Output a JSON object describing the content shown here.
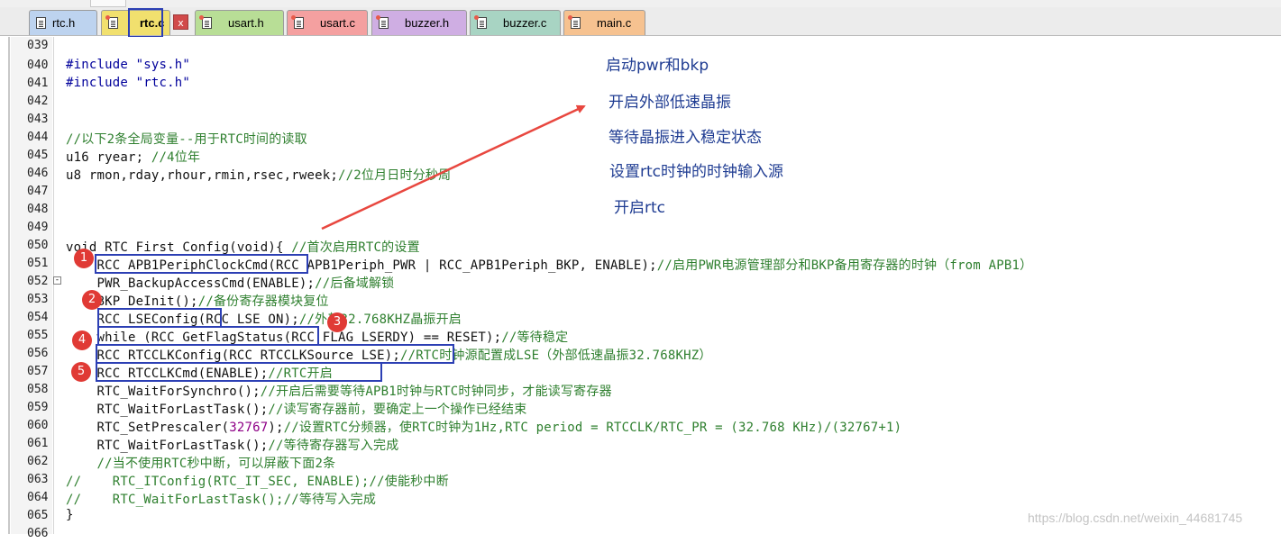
{
  "tabs": [
    {
      "label": "rtc.h",
      "color": "#bdd3ef",
      "modified": false
    },
    {
      "label": "rtc.c",
      "color": "#f1e06e",
      "modified": true,
      "active": true
    },
    {
      "label": "usart.h",
      "color": "#b8de96",
      "modified": true
    },
    {
      "label": "usart.c",
      "color": "#f4a0a0",
      "modified": true
    },
    {
      "label": "buzzer.h",
      "color": "#cfaee3",
      "modified": true
    },
    {
      "label": "buzzer.c",
      "color": "#a8d4c3",
      "modified": true
    },
    {
      "label": "main.c",
      "color": "#f6c290",
      "modified": true
    }
  ],
  "close_label": "x",
  "lines": [
    {
      "no": "039",
      "code": ""
    },
    {
      "no": "040",
      "code": "#include \"sys.h\""
    },
    {
      "no": "041",
      "code": "#include \"rtc.h\""
    },
    {
      "no": "042",
      "code": ""
    },
    {
      "no": "043",
      "code": ""
    },
    {
      "no": "044",
      "code": "//以下2条全局变量--用于RTC时间的读取"
    },
    {
      "no": "045",
      "code": "u16 ryear; //4位年"
    },
    {
      "no": "046",
      "code": "u8 rmon,rday,rhour,rmin,rsec,rweek;//2位月日时分秒周"
    },
    {
      "no": "047",
      "code": ""
    },
    {
      "no": "048",
      "code": ""
    },
    {
      "no": "049",
      "code": ""
    },
    {
      "no": "050",
      "code": "void RTC_First_Config(void){ //首次启用RTC的设置"
    },
    {
      "no": "051",
      "code": "    RCC_APB1PeriphClockCmd(RCC_APB1Periph_PWR | RCC_APB1Periph_BKP, ENABLE);//启用PWR电源管理部分和BKP备用寄存器的时钟（from APB1）"
    },
    {
      "no": "052",
      "code": "    PWR_BackupAccessCmd(ENABLE);//后备域解锁"
    },
    {
      "no": "053",
      "code": "    BKP_DeInit();//备份寄存器模块复位"
    },
    {
      "no": "054",
      "code": "    RCC_LSEConfig(RCC_LSE_ON);//外部32.768KHZ晶振开启"
    },
    {
      "no": "055",
      "code": "    while (RCC_GetFlagStatus(RCC_FLAG_LSERDY) == RESET);//等待稳定"
    },
    {
      "no": "056",
      "code": "    RCC_RTCCLKConfig(RCC_RTCCLKSource_LSE);//RTC时钟源配置成LSE（外部低速晶振32.768KHZ）"
    },
    {
      "no": "057",
      "code": "    RCC_RTCCLKCmd(ENABLE);//RTC开启"
    },
    {
      "no": "058",
      "code": "    RTC_WaitForSynchro();//开启后需要等待APB1时钟与RTC时钟同步，才能读写寄存器"
    },
    {
      "no": "059",
      "code": "    RTC_WaitForLastTask();//读写寄存器前，要确定上一个操作已经结束"
    },
    {
      "no": "060",
      "code": "    RTC_SetPrescaler(32767);//设置RTC分频器，使RTC时钟为1Hz,RTC period = RTCCLK/RTC_PR = (32.768 KHz)/(32767+1)"
    },
    {
      "no": "061",
      "code": "    RTC_WaitForLastTask();//等待寄存器写入完成"
    },
    {
      "no": "062",
      "code": "    //当不使用RTC秒中断，可以屏蔽下面2条"
    },
    {
      "no": "063",
      "code": "//    RTC_ITConfig(RTC_IT_SEC, ENABLE);//使能秒中断"
    },
    {
      "no": "064",
      "code": "//    RTC_WaitForLastTask();//等待写入完成"
    },
    {
      "no": "065",
      "code": "}"
    },
    {
      "no": "066",
      "code": ""
    }
  ],
  "badges": [
    "1",
    "2",
    "3",
    "4",
    "5"
  ],
  "annotations": [
    "启动pwr和bkp",
    "开启外部低速晶振",
    "等待晶振进入稳定状态",
    "设置rtc时钟的时钟输入源",
    "开启rtc"
  ],
  "colors": {
    "highlight_box": "#2c3fb4",
    "badge": "#e03a35",
    "arrow": "#e8473f",
    "annotation_text": "#1f3c92",
    "comment": "#2e7f2e",
    "preprocessor": "#00009b",
    "number": "#8e0086"
  },
  "watermark": "https://blog.csdn.net/weixin_44681745"
}
